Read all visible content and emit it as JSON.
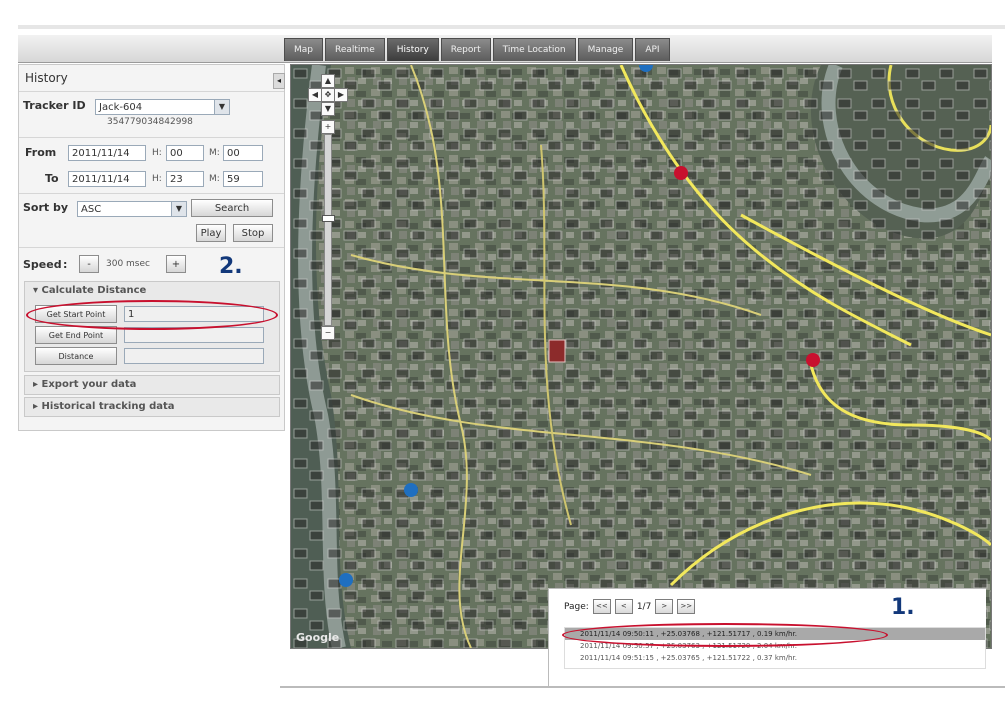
{
  "tabs": [
    "Map",
    "Realtime",
    "History",
    "Report",
    "Time Location",
    "Manage",
    "API"
  ],
  "active_tab": "History",
  "sidebar": {
    "title": "History",
    "tracker_label": "Tracker ID",
    "tracker_value": "Jack-604",
    "tracker_imei": "354779034842998",
    "from_label": "From",
    "from_date": "2011/11/14",
    "from_h_label": "H:",
    "from_hour": "00",
    "from_m_label": "M:",
    "from_minute": "00",
    "to_label": "To",
    "to_date": "2011/11/14",
    "to_h_label": "H:",
    "to_hour": "23",
    "to_m_label": "M:",
    "to_minute": "59",
    "sort_label": "Sort by",
    "sort_value": "ASC",
    "search_label": "Search",
    "play_label": "Play",
    "stop_label": "Stop",
    "speed_label": "Speed",
    "speed_minus": "-",
    "speed_value": "300 msec",
    "speed_plus": "+",
    "calc_title": "Calculate Distance",
    "get_start_label": "Get Start Point",
    "start_point_value": "1",
    "get_end_label": "Get End Point",
    "distance_label": "Distance",
    "export_title": "Export your data",
    "historical_title": "Historical tracking data"
  },
  "annotations": {
    "one": "1.",
    "two": "2."
  },
  "map": {
    "attribution": "Google"
  },
  "results": {
    "page_label": "Page:",
    "first": "<<",
    "prev": "<",
    "page_value": "1/7",
    "next": ">",
    "last": ">>",
    "rows": [
      "2011/11/14 09:50:11 , +25.03768 , +121.51717 , 0.19 km/hr.",
      "2011/11/14 09:50:57 , +25.03763 , +121.51720 , 2.04 km/hr.",
      "2011/11/14 09:51:15 , +25.03765 , +121.51722 , 0.37 km/hr."
    ]
  },
  "colors": {
    "annotation_red": "#c8102e",
    "annotation_blue": "#12387a",
    "tab_dark": "#5c5c5c"
  }
}
